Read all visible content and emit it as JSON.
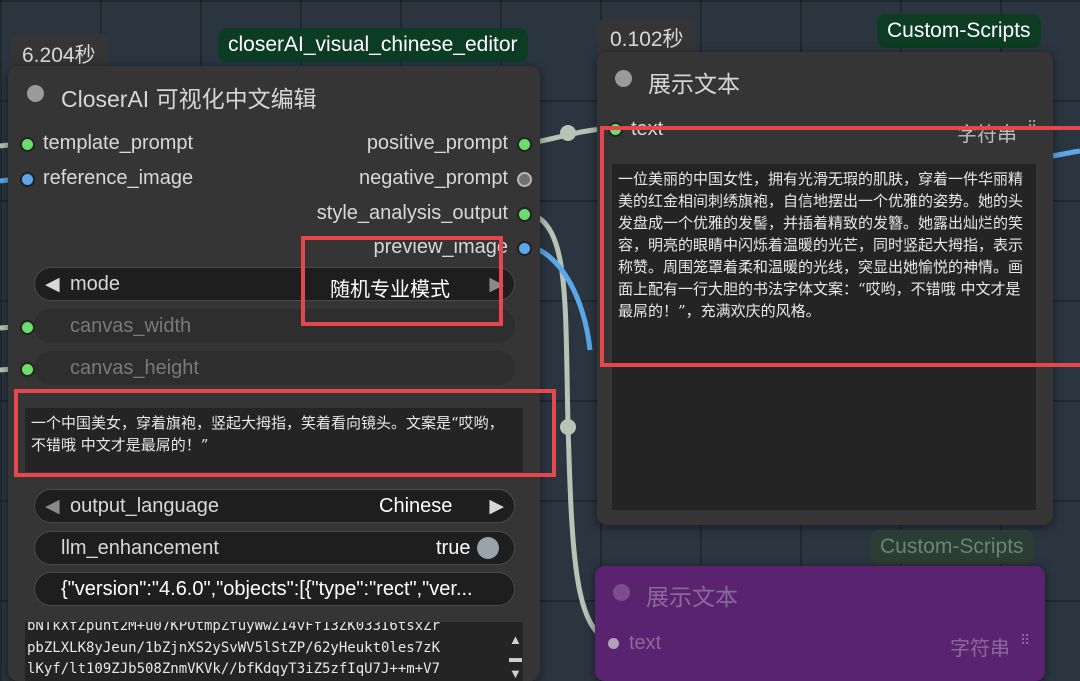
{
  "node_left": {
    "time_badge": "6.204秒",
    "name_badge": "closerAI_visual_chinese_editor",
    "title": "CloserAI 可视化中文编辑",
    "inputs": [
      "template_prompt",
      "reference_image"
    ],
    "outputs": [
      "positive_prompt",
      "negative_prompt",
      "style_analysis_output",
      "preview_image"
    ],
    "mode": {
      "label": "mode",
      "value": "随机专业模式"
    },
    "canvas_width": "canvas_width",
    "canvas_height": "canvas_height",
    "prompt_text": "一个中国美女，穿着旗袍，竖起大拇指，笑着看向镜头。文案是“哎哟，不错哦 中文才是最屌的！”",
    "output_language": {
      "label": "output_language",
      "value": "Chinese"
    },
    "llm_enhancement": {
      "label": "llm_enhancement",
      "value": "true"
    },
    "json_value": "{\"version\":\"4.6.0\",\"objects\":[{\"type\":\"rect\",\"ver...",
    "base64_lines": [
      "bNTkXfZpunt2M+u07KPOtmpZfuyWwZ14vFf13ZK033I6tsxZr",
      "pbZLXLK8yJeun/1bZjnXS2ySvWV5lStZP/62yHeukt0les7zK",
      "lKyf/lt109ZJb508ZnmVKVk//bfKdqyT3iZ5zfIqU7J++m+V7"
    ]
  },
  "node_right_top": {
    "time_badge": "0.102秒",
    "name_badge": "Custom-Scripts",
    "title": "展示文本",
    "input_label": "text",
    "input_type": "字符串",
    "display_text": "一位美丽的中国女性，拥有光滑无瑕的肌肤，穿着一件华丽精美的红金相间刺绣旗袍，自信地摆出一个优雅的姿势。她的头发盘成一个优雅的发髻，并插着精致的发簪。她露出灿烂的笑容，明亮的眼睛中闪烁着温暖的光芒，同时竖起大拇指，表示称赞。周围笼罩着柔和温暖的光线，突显出她愉悦的神情。画面上配有一行大胆的书法字体文案：“哎哟，不错哦 中文才是最屌的！”，充满欢庆的风格。"
  },
  "node_right_bottom": {
    "name_badge": "Custom-Scripts",
    "title": "展示文本",
    "input_label": "text",
    "input_type": "字符串"
  },
  "colors": {
    "highlight": "#e5474d",
    "purple_node": "#5a2370",
    "name_badge_bg": "#0c3d24"
  }
}
